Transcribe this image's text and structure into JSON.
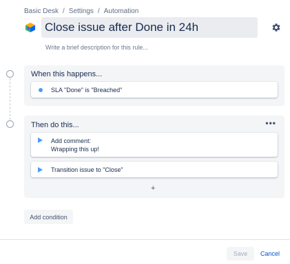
{
  "breadcrumb": {
    "items": [
      "Basic Desk",
      "Settings",
      "Automation"
    ],
    "separator": "/"
  },
  "rule": {
    "title": "Close issue after Done in 24h",
    "description_placeholder": "Write a brief description for this rule..."
  },
  "trigger_section": {
    "title": "When this happens...",
    "card_text": "SLA \"Done\" is \"Breached\""
  },
  "action_section": {
    "title": "Then do this...",
    "more_label": "•••",
    "actions": [
      {
        "line1": "Add comment:",
        "line2": "Wrapping this up!"
      },
      {
        "line1": "Transition issue to \"Close\""
      }
    ],
    "add_label": "+"
  },
  "add_condition_label": "Add condition",
  "footer": {
    "save_label": "Save",
    "cancel_label": "Cancel"
  },
  "icons": {
    "project": "project-cube-icon",
    "settings": "gear-icon",
    "trigger": "dot-icon",
    "action": "play-icon"
  },
  "colors": {
    "accent": "#4c9aff",
    "link": "#0052cc",
    "panel": "#f4f5f7",
    "title_bg": "#ebecf0"
  }
}
